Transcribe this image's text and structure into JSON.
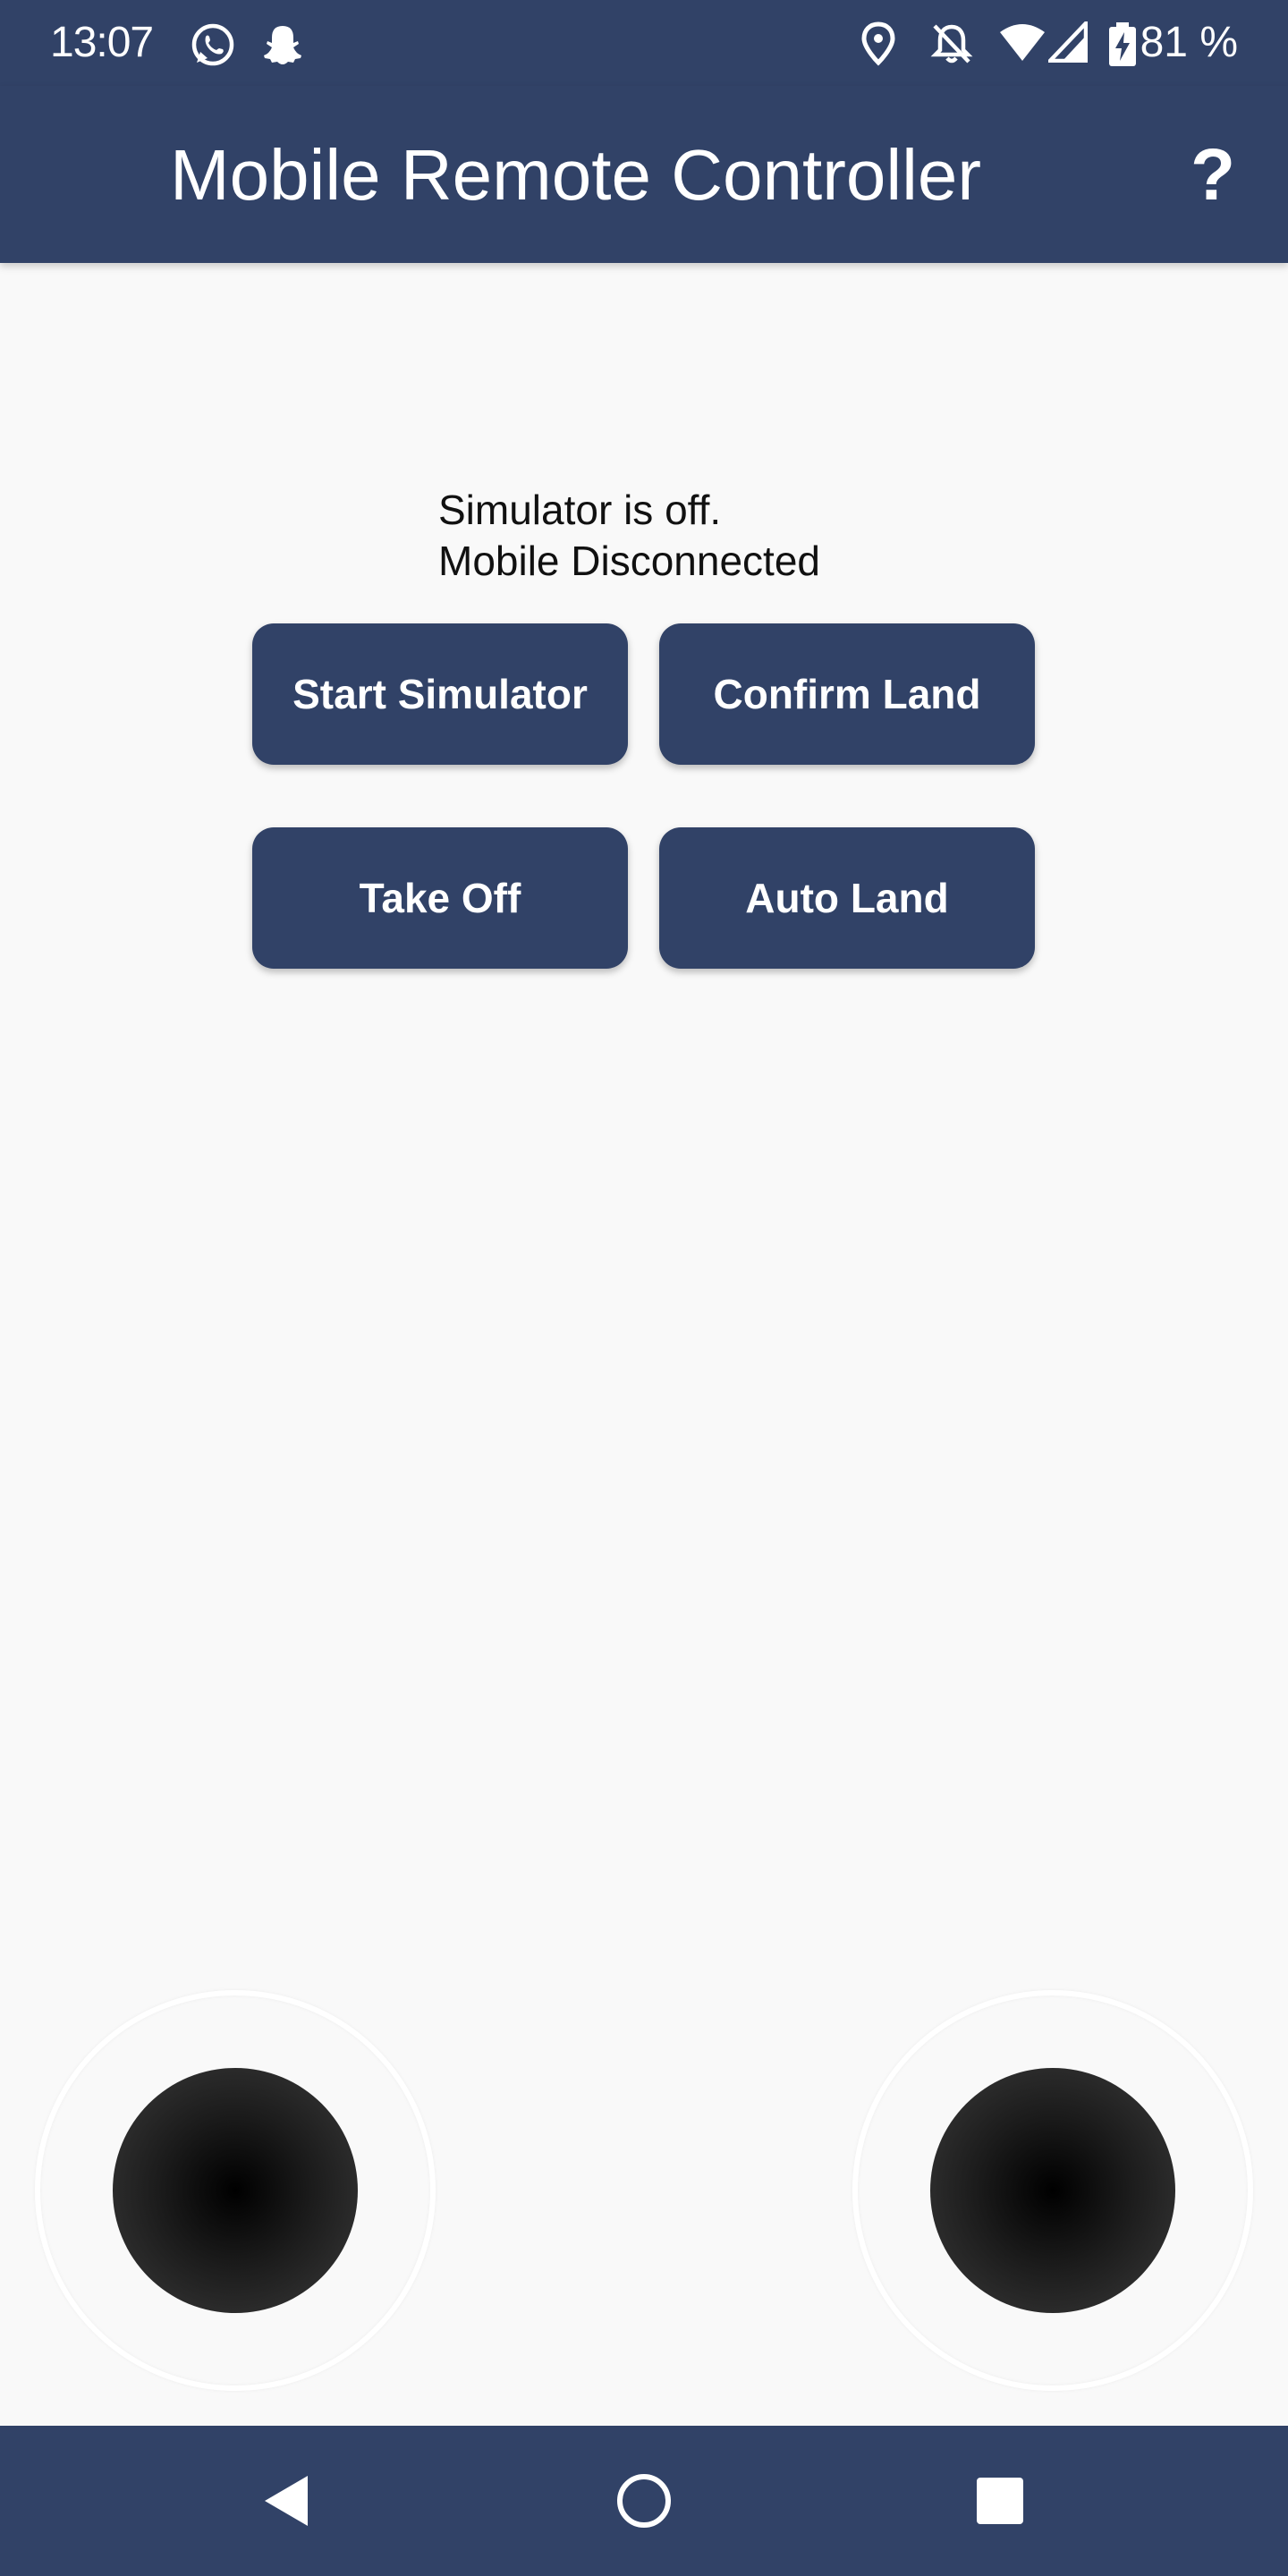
{
  "status_bar": {
    "time": "13:07",
    "battery": "81 %",
    "icons": [
      "whatsapp-icon",
      "snapchat-icon",
      "location-icon",
      "bell-off-icon",
      "wifi-icon",
      "signal-icon",
      "battery-charging-icon"
    ]
  },
  "app_bar": {
    "title": "Mobile Remote Controller",
    "help_label": "?"
  },
  "status": {
    "simulator": "Simulator is off.",
    "connection": "Mobile Disconnected"
  },
  "buttons": {
    "start_simulator": "Start Simulator",
    "confirm_land": "Confirm Land",
    "take_off": "Take Off",
    "auto_land": "Auto Land"
  },
  "joysticks": [
    "left-joystick",
    "right-joystick"
  ],
  "nav_bar": {
    "icons": [
      "back-icon",
      "home-icon",
      "recents-icon"
    ]
  },
  "colors": {
    "primary": "#314267",
    "background": "#f9f9f9",
    "knob": "#000000"
  }
}
